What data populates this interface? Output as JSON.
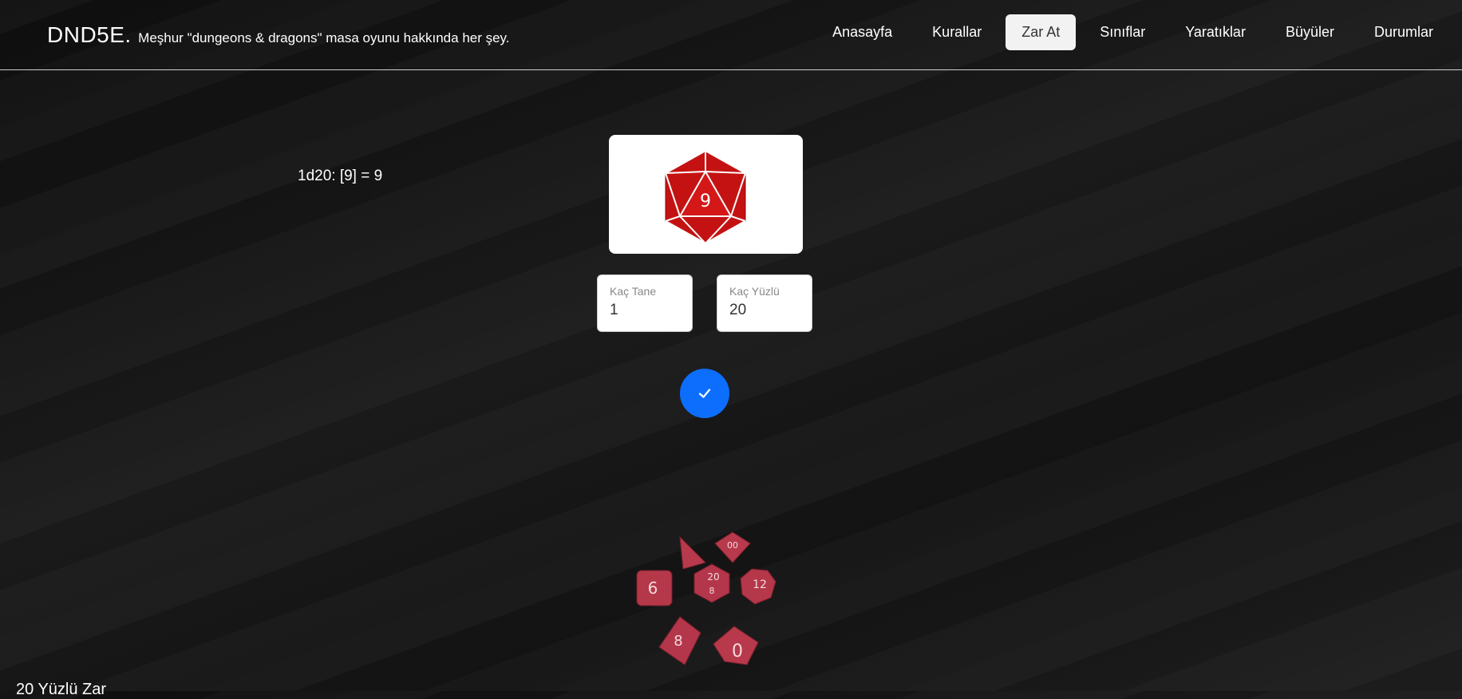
{
  "brand": {
    "name": "DND5E.",
    "tagline": "Meşhur \"dungeons & dragons\" masa oyunu hakkında her şey."
  },
  "nav": {
    "items": [
      {
        "label": "Anasayfa"
      },
      {
        "label": "Kurallar"
      },
      {
        "label": "Zar At",
        "active": true
      },
      {
        "label": "Sınıflar"
      },
      {
        "label": "Yaratıklar"
      },
      {
        "label": "Büyüler"
      },
      {
        "label": "Durumlar"
      }
    ]
  },
  "roll": {
    "result_text": "1d20: [9] = 9",
    "die_face": "9"
  },
  "form": {
    "count_label": "Kaç Tane",
    "count_value": "1",
    "sides_label": "Kaç Yüzlü",
    "sides_value": "20",
    "submit_icon": "check-icon"
  },
  "dice_set": {
    "labels": [
      "00",
      "6",
      "20",
      "8",
      "12",
      "8",
      "0"
    ]
  },
  "section": {
    "title": "20 Yüzlü Zar"
  },
  "colors": {
    "accent": "#0d6efd",
    "die_red": "#c41212",
    "active_nav_bg": "#f2f2f2"
  }
}
